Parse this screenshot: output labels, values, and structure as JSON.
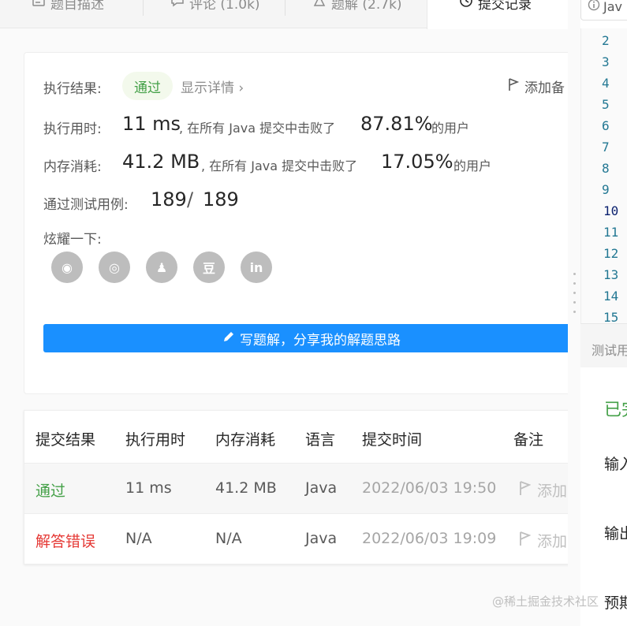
{
  "tabs": [
    {
      "label": "题目描述",
      "icon": "description-icon"
    },
    {
      "label": "评论 (1.0k)",
      "icon": "comment-icon"
    },
    {
      "label": "题解 (2.7k)",
      "icon": "flask-icon"
    },
    {
      "label": "提交记录",
      "icon": "clock-icon"
    }
  ],
  "result": {
    "status_label": "执行结果:",
    "status_value": "通过",
    "detail_link": "显示详情",
    "add_note": "添加备",
    "time_label": "执行用时:",
    "time_value": "11 ms",
    "time_text": ", 在所有 Java 提交中击败了",
    "time_percent": "87.81%",
    "time_suffix": "的用户",
    "mem_label": "内存消耗:",
    "mem_value": "41.2 MB",
    "mem_text": ", 在所有 Java 提交中击败了",
    "mem_percent": "17.05%",
    "mem_suffix": "的用户",
    "cases_label": "通过测试用例:",
    "cases_passed": "189",
    "cases_sep": "/",
    "cases_total": "189",
    "share_label": "炫耀一下:",
    "share_icons": [
      "wechat-icon",
      "weibo-icon",
      "qq-icon",
      "douban-icon",
      "linkedin-icon"
    ],
    "share_glyphs": [
      "◉",
      "◎",
      "♟",
      "豆",
      "in"
    ],
    "write_button": "写题解，分享我的解题思路"
  },
  "table": {
    "headers": [
      "提交结果",
      "执行用时",
      "内存消耗",
      "语言",
      "提交时间",
      "备注"
    ],
    "rows": [
      {
        "result": "通过",
        "time": "11 ms",
        "memory": "41.2 MB",
        "lang": "Java",
        "submitted": "2022/06/03 19:50",
        "note": "添加"
      },
      {
        "result": "解答错误",
        "time": "N/A",
        "memory": "N/A",
        "lang": "Java",
        "submitted": "2022/06/03 19:09",
        "note": "添加"
      }
    ]
  },
  "editor": {
    "lang_button": "Jav",
    "line_numbers": [
      "2",
      "3",
      "4",
      "5",
      "6",
      "7",
      "8",
      "9",
      "10",
      "11",
      "12",
      "13",
      "14",
      "15"
    ],
    "current_line": "10",
    "test_bar_label": "测试用",
    "done": "已完",
    "input_label": "输入",
    "output_label": "输出",
    "expected_label": "预期"
  },
  "watermark": "@稀土掘金技术社区",
  "colors": {
    "accent": "#1a90ff",
    "success": "#43a047",
    "error": "#e53935"
  }
}
